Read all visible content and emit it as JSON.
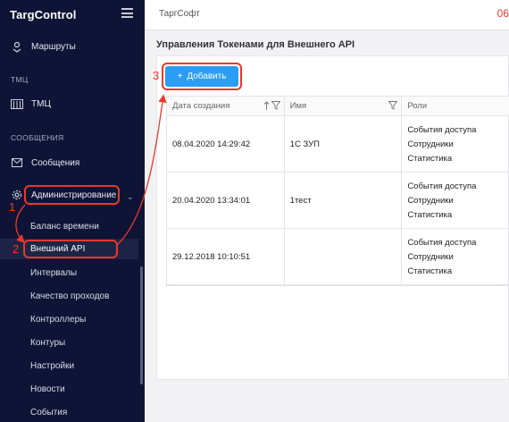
{
  "app": {
    "logo": "TargControl"
  },
  "sidebar": {
    "routes_label": "Маршруты",
    "section_tmc": "ТМЦ",
    "tmc_label": "ТМЦ",
    "section_messages": "СООБЩЕНИЯ",
    "messages_label": "Сообщения",
    "admin_label": "Администрирование",
    "sub_items": [
      "Баланс времени",
      "Внешний API",
      "Интервалы",
      "Качество проходов",
      "Контроллеры",
      "Контуры",
      "Настройки",
      "Новости",
      "События"
    ]
  },
  "topbar": {
    "company": "ТаргСофт",
    "right_text": "06"
  },
  "page": {
    "title": "Управления Токенами для Внешнего API",
    "add_button": "Добавить"
  },
  "table": {
    "headers": [
      "Дата создания",
      "Имя",
      "Роли"
    ],
    "rows": [
      {
        "date": "08.04.2020 14:29:42",
        "name": "1С ЗУП",
        "roles": [
          "События доступа",
          "Сотрудники",
          "Статистика"
        ]
      },
      {
        "date": "20.04.2020 13:34:01",
        "name": "1тест",
        "roles": [
          "События доступа",
          "Сотрудники",
          "Статистика"
        ]
      },
      {
        "date": "29.12.2018 10:10:51",
        "name": "",
        "roles": [
          "События доступа",
          "Сотрудники",
          "Статистика"
        ]
      }
    ]
  },
  "annotations": {
    "step1": "1",
    "step2": "2",
    "step3": "3"
  },
  "colors": {
    "sidebar_bg": "#0f1437",
    "accent": "#2a9df4",
    "annotation": "#e8382c"
  }
}
